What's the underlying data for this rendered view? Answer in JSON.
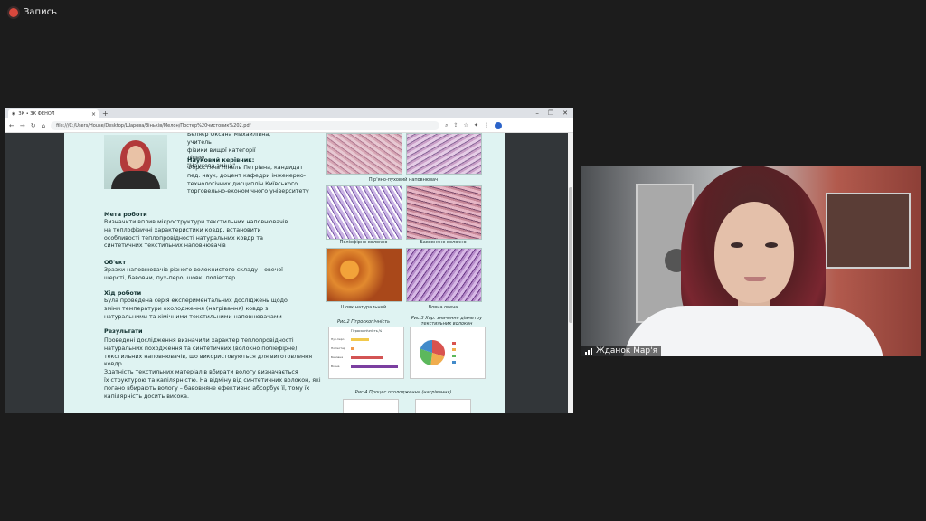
{
  "recording": {
    "label": "Запись"
  },
  "browser": {
    "tab_title": "ЗК • ЗК ФЕНОЛ",
    "url": "file:///C:/Users/House/Desktop/Шарова/Зіньків/Мелон/Постер%20чистовик%202.pdf",
    "win_controls": [
      "–",
      "❐",
      "✕"
    ]
  },
  "poster": {
    "intro_lines": [
      "Беляєр Оксана Михайлівна, учитель",
      "фізики вищої категорії ліцею",
      "\"Наукова зміна\""
    ],
    "supervisor_heading": "Науковий керівник:",
    "supervisor_lines": [
      "Форостяна Нінель Петрівна, кандидат",
      "пед. наук, доцент кафедри інженерно-",
      "технологічних дисциплін Київського",
      "торговельно-економічного університету"
    ],
    "goal_heading": "Мета роботи",
    "goal_lines": [
      "Визначити вплив мікроструктури текстильних наповнювачів",
      "на теплофізичні характеристики ковдр, встановити",
      "особливості теплопровідності натуральних ковдр та",
      "синтетичних текстильних наповнювачів"
    ],
    "object_heading": "Об'єкт",
    "object_lines": [
      "Зразки наповнювачів різного волокнистого складу – овечої",
      "шерсті, бавовни, пух-перо, шовк, поліестер"
    ],
    "process_heading": "Хід роботи",
    "process_lines": [
      "Була проведена серія експериментальних досліджень щодо",
      "зміни температури охолодження (нагрівання) ковдр з",
      "натуральними та хімічними текстильними наповнювачами"
    ],
    "results_heading": "Результати",
    "results_lines": [
      "Проведені дослідження визначили характер теплопровідності",
      "натуральних походження та синтетичних (волокно поліефірне)",
      "текстильних наповнювачів, що використовуються для виготовлення",
      "ковдр.",
      "Здатність текстильних матеріалів вбирати вологу визначається",
      "їх структурою та капілярністю. На відміну від синтетичних волокон, які",
      "погано вбирають вологу – бавовняне ефективно абсорбує її, тому їх",
      "капілярність досить висока."
    ],
    "captions": {
      "down": "Пір'яно-пуховий наповнювач",
      "polyester": "Поліефірне волокно",
      "cotton": "Бавовняне волокно",
      "silk": "Шовк натуральний",
      "wool": "Вовна овеча"
    },
    "fig2_title": "Рис.2 Гігроскопічність",
    "fig2_chart_title": "Гігроскопічність,%",
    "fig3_title": "Рис.3 Хар. значення діаметру текстильних волокон",
    "fig4_title": "Рис.4 Процес охолодження (нагрівання)"
  },
  "chart_data": [
    {
      "type": "bar",
      "title": "Гігроскопічність,%",
      "categories": [
        "Пух-перо",
        "Поліестер",
        "Бавовна",
        "Вовна"
      ],
      "values": [
        5,
        1,
        9,
        13
      ],
      "colors": [
        "#f2c94c",
        "#f2994a",
        "#d35454",
        "#7b3fa0"
      ]
    },
    {
      "type": "pie",
      "values": [
        30,
        22,
        28,
        20
      ],
      "colors": [
        "#d9534f",
        "#f0ad4e",
        "#5cb85c",
        "#428bca"
      ]
    }
  ],
  "camera": {
    "participant_name": "Жданок Мар'я"
  }
}
